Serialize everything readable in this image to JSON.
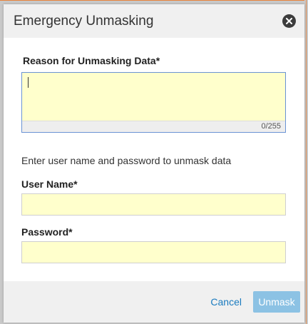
{
  "dialog": {
    "title": "Emergency Unmasking",
    "close_icon": "close-circle-icon"
  },
  "form": {
    "reason": {
      "label": "Reason for Unmasking Data*",
      "value": "",
      "char_count": "0/255"
    },
    "hint": "Enter user name and password to unmask data",
    "username": {
      "label": "User Name*",
      "value": ""
    },
    "password": {
      "label": "Password*",
      "value": ""
    }
  },
  "footer": {
    "cancel_label": "Cancel",
    "unmask_label": "Unmask"
  },
  "colors": {
    "input_bg": "#ffffcc",
    "link": "#1a7bbf",
    "primary_disabled": "#8cc2e4",
    "accent_border": "#e8833a"
  }
}
